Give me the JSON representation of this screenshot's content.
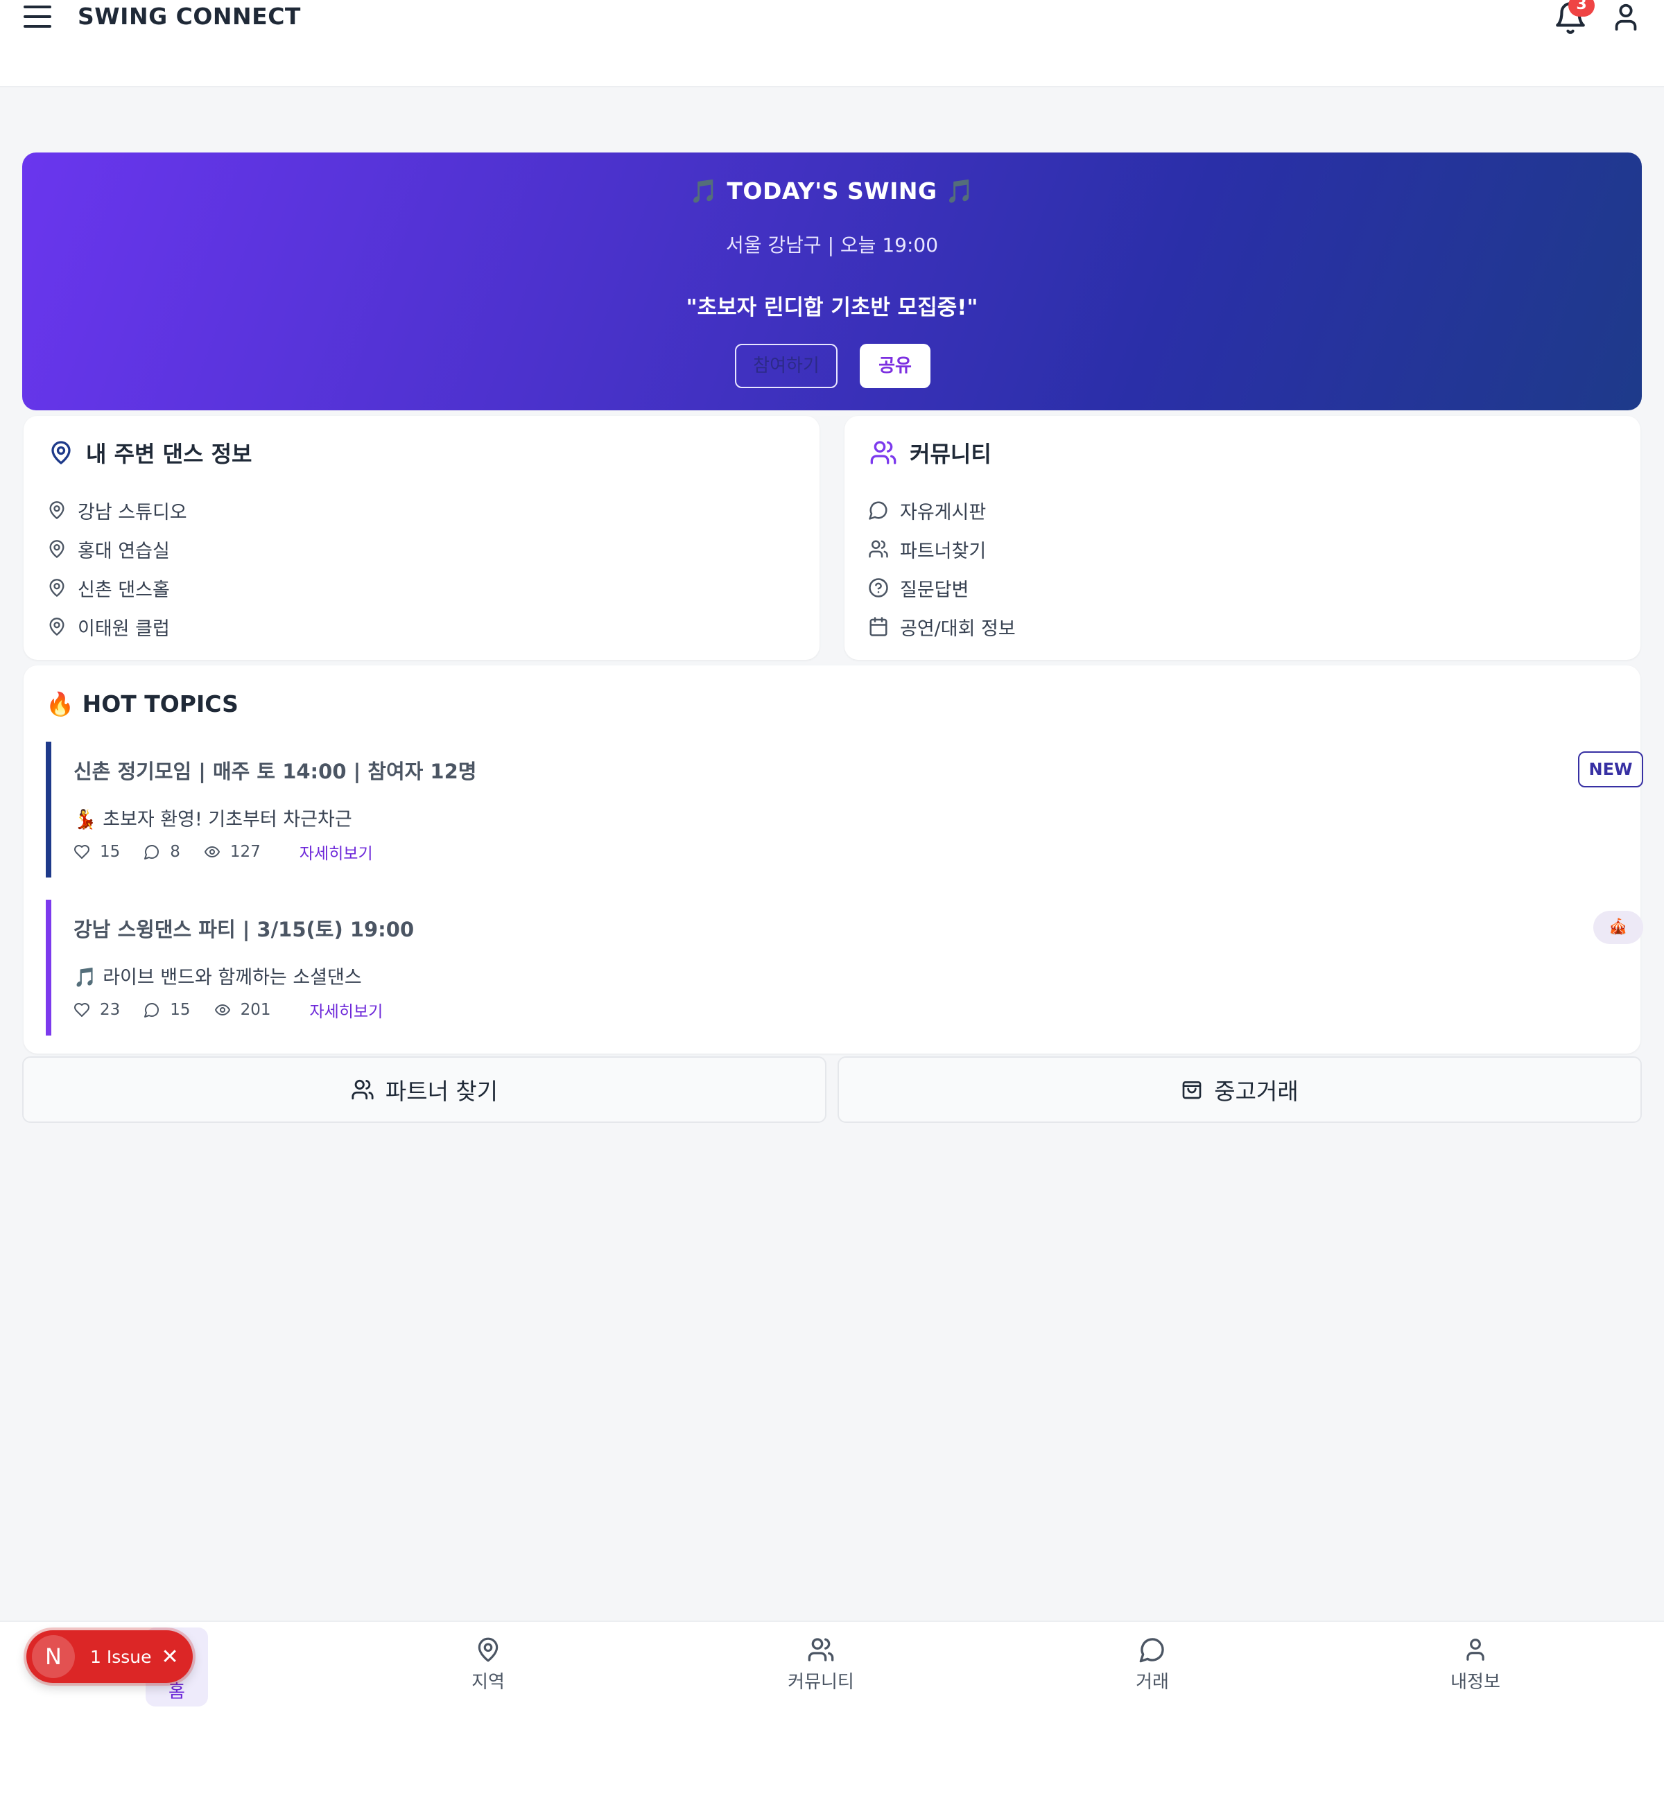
{
  "header": {
    "brand": "SWING CONNECT",
    "notification_count": "3"
  },
  "hero": {
    "title": "🎵 TODAY'S SWING 🎵",
    "subtitle": "서울 강남구 | 오늘 19:00",
    "quote": "\"초보자 린디합 기초반 모집중!\"",
    "join_label": "참여하기",
    "share_label": "공유"
  },
  "nearby": {
    "title": "내 주변 댄스 정보",
    "items": [
      "강남 스튜디오",
      "홍대 연습실",
      "신촌 댄스홀",
      "이태원 클럽"
    ]
  },
  "community": {
    "title": "커뮤니티",
    "items": [
      {
        "label": "자유게시판",
        "icon": "chat-icon"
      },
      {
        "label": "파트너찾기",
        "icon": "users-icon"
      },
      {
        "label": "질문답변",
        "icon": "question-icon"
      },
      {
        "label": "공연/대회 정보",
        "icon": "calendar-icon"
      }
    ]
  },
  "hot_topics": {
    "title": "🔥 HOT TOPICS",
    "topics": [
      {
        "headline": "신촌 정기모임 | 매주 토 14:00 | 참여자 12명",
        "description": "💃 초보자 환영! 기초부터 차근차근",
        "likes": "15",
        "comments": "8",
        "views": "127",
        "more_label": "자세히보기",
        "tag": "NEW",
        "accent": "#1e3a8a"
      },
      {
        "headline": "강남 스윙댄스 파티 | 3/15(토) 19:00",
        "description": "🎵 라이브 밴드와 함께하는 소셜댄스",
        "likes": "23",
        "comments": "15",
        "views": "201",
        "more_label": "자세히보기",
        "tag": "🎪",
        "accent": "#7c3aed"
      }
    ]
  },
  "actions": {
    "partner_label": "파트너 찾기",
    "market_label": "중고거래"
  },
  "bottom_nav": {
    "home_label": "홈",
    "items": [
      "지역",
      "커뮤니티",
      "거래",
      "내정보"
    ]
  },
  "issue_toast": {
    "avatar_letter": "N",
    "label": "1 Issue"
  },
  "colors": {
    "accent_purple": "#6d28d9",
    "hero_gradient_start": "#6a36ee",
    "hero_gradient_end": "#1e3a8a",
    "badge_red": "#ef4444"
  }
}
